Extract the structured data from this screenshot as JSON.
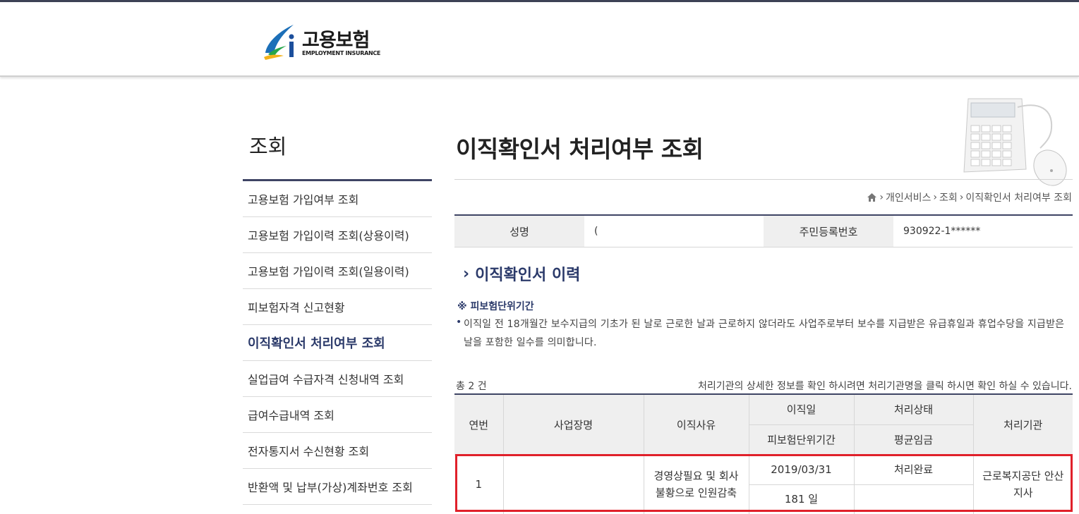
{
  "header": {
    "logo_ko": "고용보험",
    "logo_en": "EMPLOYMENT INSURANCE"
  },
  "sidebar": {
    "title": "조회",
    "items": [
      {
        "label": "고용보험 가입여부 조회"
      },
      {
        "label": "고용보험 가입이력 조회(상용이력)"
      },
      {
        "label": "고용보험 가입이력 조회(일용이력)"
      },
      {
        "label": "피보험자격 신고현황"
      },
      {
        "label": "이직확인서 처리여부 조회"
      },
      {
        "label": "실업급여 수급자격 신청내역 조회"
      },
      {
        "label": "급여수급내역 조회"
      },
      {
        "label": "전자통지서 수신현황 조회"
      },
      {
        "label": "반환액 및 납부(가상)계좌번호 조회"
      }
    ],
    "active_index": 4
  },
  "main": {
    "title": "이직확인서 처리여부 조회",
    "breadcrumb": [
      "개인서비스",
      "조회",
      "이직확인서 처리여부 조회"
    ]
  },
  "info": {
    "name_label": "성명",
    "name_value": "(",
    "rrn_label": "주민등록번호",
    "rrn_value": "930922-1******"
  },
  "section": {
    "title": "이직확인서 이력",
    "note_title": "※ 피보험단위기간",
    "note_text": "이직일 전 18개월간 보수지급의 기초가 된 날로 근로한 날과 근로하지 않더라도 사업주로부터 보수를 지급받은 유급휴일과 휴업수당을 지급받은 날을 포함한 일수를 의미합니다.",
    "total": "총 2 건",
    "help": "처리기관의 상세한 정보를 확인 하시려면 처리기관명을 클릭 하시면 확인 하실 수 있습니다."
  },
  "table": {
    "headers": {
      "no": "연번",
      "workplace": "사업장명",
      "reason": "이직사유",
      "leave_date": "이직일",
      "status": "처리상태",
      "agency": "처리기관",
      "period": "피보험단위기간",
      "avg_wage": "평균임금"
    },
    "rows": [
      {
        "no": "1",
        "workplace": "",
        "reason": "경영상필요 및 회사불황으로 인원감축",
        "leave_date": "2019/03/31",
        "status": "처리완료",
        "period": "181 일",
        "avg_wage": "",
        "agency": "근로복지공단 안산지사"
      }
    ]
  },
  "colors": {
    "navy": "#2b3a6a",
    "header_bar": "#3e4464",
    "highlight": "#e0202a"
  }
}
